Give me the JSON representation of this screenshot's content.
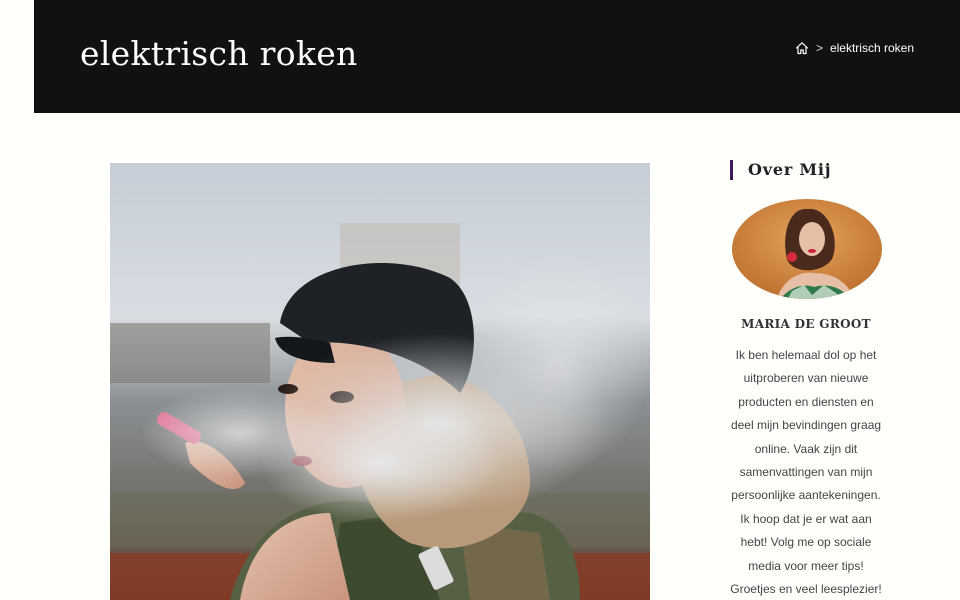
{
  "header": {
    "title": "elektrisch roken",
    "breadcrumb": {
      "home_icon": "home-icon",
      "separator": ">",
      "current": "elektrisch roken"
    }
  },
  "featured_image": {
    "subject": "woman-with-cap-exhaling-vapor"
  },
  "sidebar": {
    "widget_title": "Over Mij",
    "author_name": "MARIA DE GROOT",
    "author_bio": "Ik ben helemaal dol op het uitproberen van nieuwe producten en diensten en deel mijn bevindingen graag online. Vaak zijn dit samenvattingen van mijn persoonlijke aantekeningen. Ik hoop dat je er wat aan hebt! Volg me op sociale media voor meer tips! Groetjes en veel leesplezier!"
  },
  "colors": {
    "header_bg": "#111111",
    "accent": "#3c1a5b",
    "page_bg": "#fffffc"
  }
}
